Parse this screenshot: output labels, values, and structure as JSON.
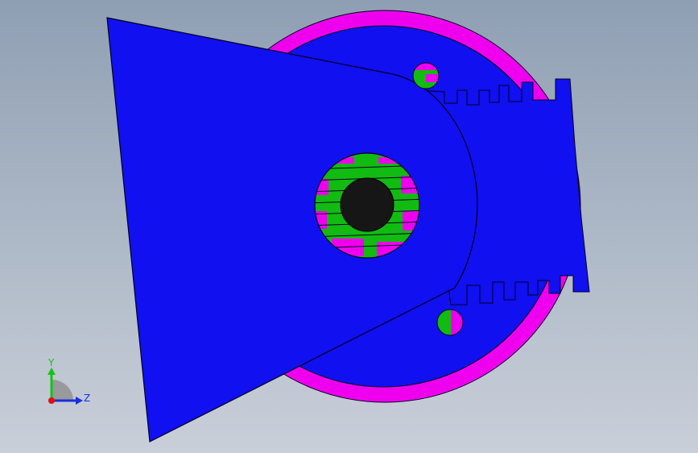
{
  "viewport": {
    "background_top": "#8f9fb3",
    "background_bottom": "#c9cfd9"
  },
  "model": {
    "colors": {
      "plate": "#1010f0",
      "ring": "#ee00ee",
      "pin": "#11bb11",
      "bore": "#161616",
      "edge": "#000020"
    }
  },
  "triad": {
    "y_label": "Y",
    "z_label": "Z",
    "y_color": "#13c413",
    "z_color": "#1a2ee0",
    "x_color": "#e01010"
  }
}
